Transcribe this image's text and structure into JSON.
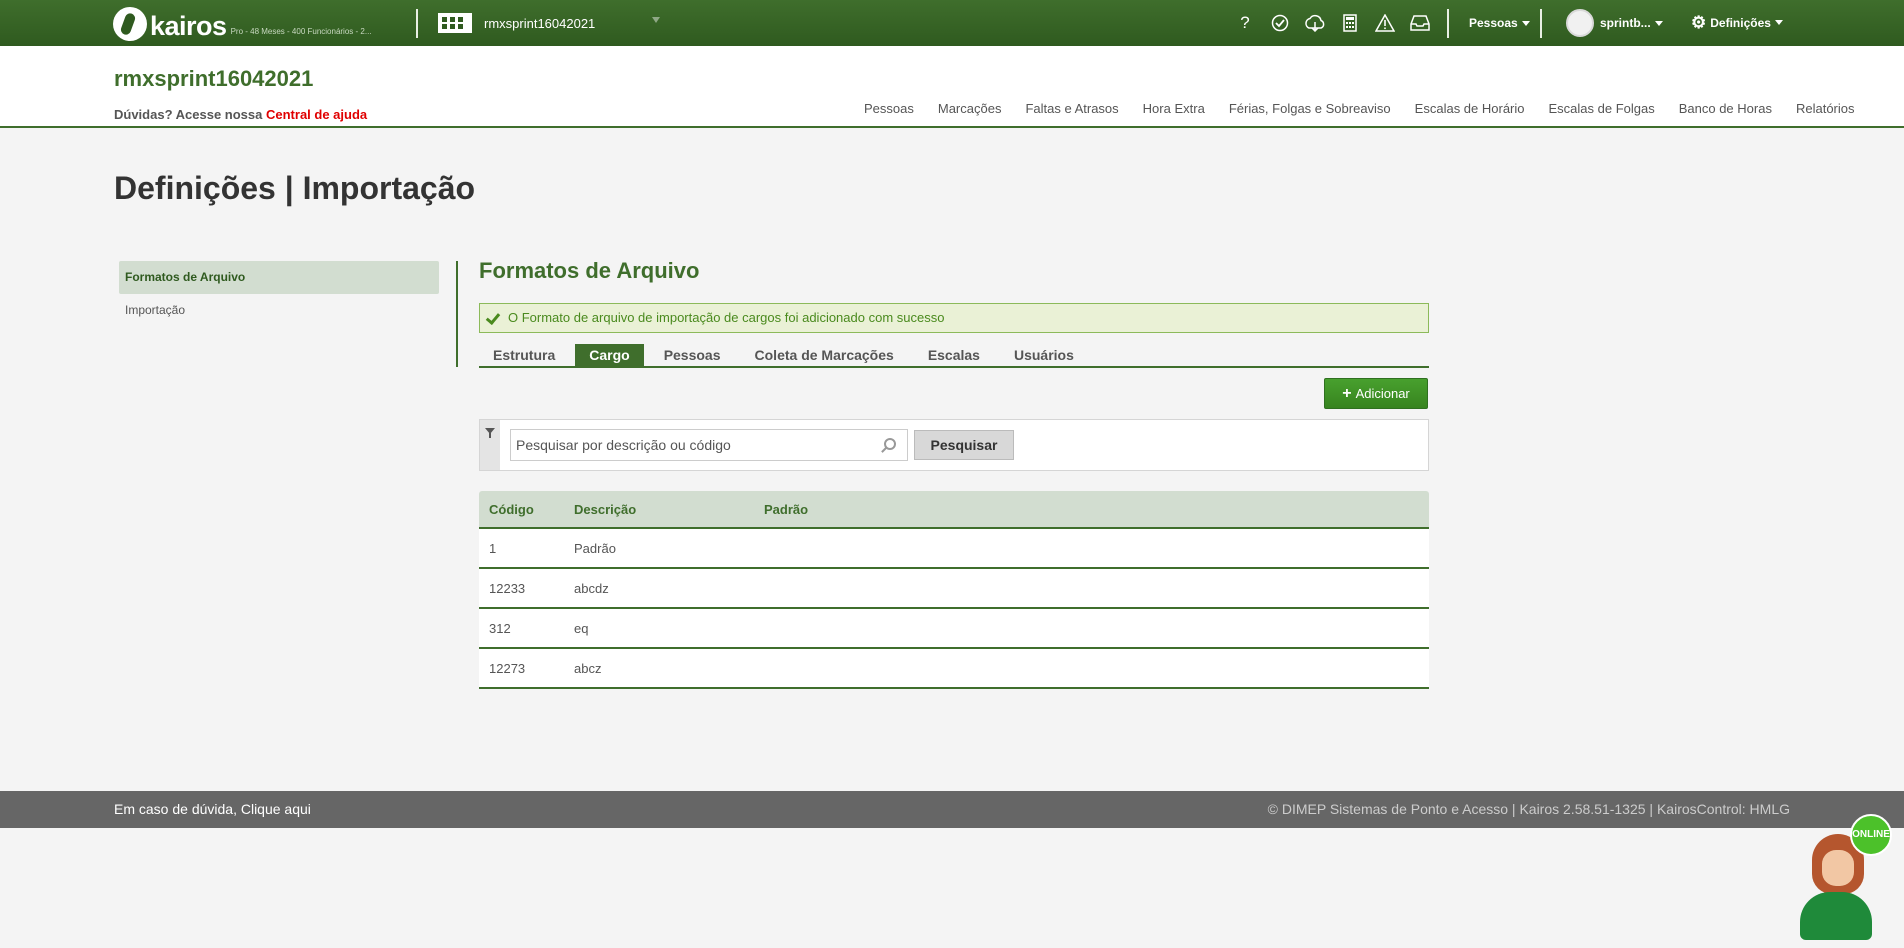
{
  "topbar": {
    "logo_text": "kairos",
    "plan_text": "Pro - 48 Meses - 400 Funcionários - 2...",
    "company_name": "rmxsprint16042021",
    "icons": [
      "help-icon",
      "check-badge-icon",
      "cloud-sync-icon",
      "calculator-icon",
      "warning-icon",
      "inbox-icon"
    ],
    "help_glyph": "?",
    "pessoas_label": "Pessoas",
    "user_name": "sprintb...",
    "settings_label": "Definições"
  },
  "header": {
    "title": "rmxsprint16042021",
    "help_prefix": "Dúvidas? Acesse nossa",
    "help_link": "Central de ajuda",
    "nav": [
      "Pessoas",
      "Marcações",
      "Faltas e Atrasos",
      "Hora Extra",
      "Férias, Folgas e Sobreaviso",
      "Escalas de Horário",
      "Escalas de Folgas",
      "Banco de Horas",
      "Relatórios"
    ]
  },
  "page": {
    "title": "Definições | Importação"
  },
  "sidebar": {
    "items": [
      {
        "label": "Formatos de Arquivo"
      },
      {
        "label": "Importação"
      }
    ]
  },
  "content": {
    "section_title": "Formatos de Arquivo",
    "alert": "O Formato de arquivo de importação de cargos foi adicionado com sucesso",
    "tabs": [
      "Estrutura",
      "Cargo",
      "Pessoas",
      "Coleta de Marcações",
      "Escalas",
      "Usuários"
    ],
    "active_tab": "Cargo",
    "add_button": "Adicionar",
    "add_glyph": "+",
    "search_placeholder": "Pesquisar por descrição ou código",
    "search_button": "Pesquisar",
    "table": {
      "columns": [
        "Código",
        "Descrição",
        "Padrão"
      ],
      "rows": [
        [
          "1",
          "Padrão",
          ""
        ],
        [
          "12233",
          "abcdz",
          ""
        ],
        [
          "312",
          "eq",
          ""
        ],
        [
          "12273",
          "abcz",
          ""
        ]
      ]
    }
  },
  "footer": {
    "left": "Em caso de dúvida, Clique aqui",
    "right": "© DIMEP Sistemas de Ponto e Acesso | Kairos 2.58.51-1325 | KairosControl: HMLG"
  },
  "chat": {
    "badge": "ONLINE"
  },
  "colors": {
    "brand_green": "#3f6e2c",
    "success_bg": "#eaf1d6",
    "add_button": "#48a02e",
    "help_link": "#e00000"
  }
}
